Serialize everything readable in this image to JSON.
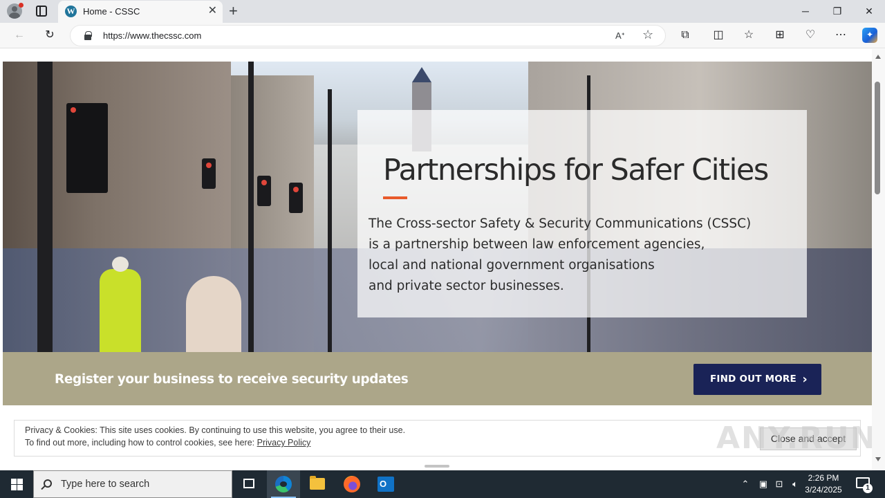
{
  "browser": {
    "tab_title": "Home - CSSC",
    "tab_favicon": "W",
    "tab_close": "✕",
    "new_tab": "+",
    "url": "https://www.thecssc.com"
  },
  "hero": {
    "title": "Partnerships for Safer Cities",
    "body_lines": [
      "The Cross-sector Safety & Security Communications (CSSC)",
      "is a partnership between law enforcement agencies,",
      "local and national government organisations",
      "and private sector businesses."
    ]
  },
  "band": {
    "text": "Register your business to receive security updates",
    "button_label": "FIND OUT MORE"
  },
  "cookie": {
    "line1": "Privacy & Cookies: This site uses cookies. By continuing to use this website, you agree to their use.",
    "line2_prefix": "To find out more, including how to control cookies, see here: ",
    "link": "Privacy Policy",
    "button": "Close and accept"
  },
  "watermark": "ANY.RUN",
  "taskbar": {
    "search_placeholder": "Type here to search",
    "time": "2:26 PM",
    "date": "3/24/2025",
    "notification_count": "1"
  },
  "icons": [
    "profile-icon",
    "tab-actions-icon",
    "wordpress-icon",
    "back-icon",
    "refresh-icon",
    "lock-icon",
    "read-aloud-icon",
    "favorite-star-icon",
    "extensions-icon",
    "split-screen-icon",
    "favorites-icon",
    "collections-icon",
    "performance-icon",
    "more-icon",
    "copilot-icon",
    "windows-start-icon",
    "search-icon",
    "task-view-icon",
    "edge-icon",
    "file-explorer-icon",
    "firefox-icon",
    "outlook-icon",
    "chevron-up-icon",
    "network-icon",
    "volume-icon",
    "notification-icon"
  ],
  "colors": {
    "accent_orange": "#e85a2a",
    "band": "#aca689",
    "button_navy": "#1a2357"
  }
}
